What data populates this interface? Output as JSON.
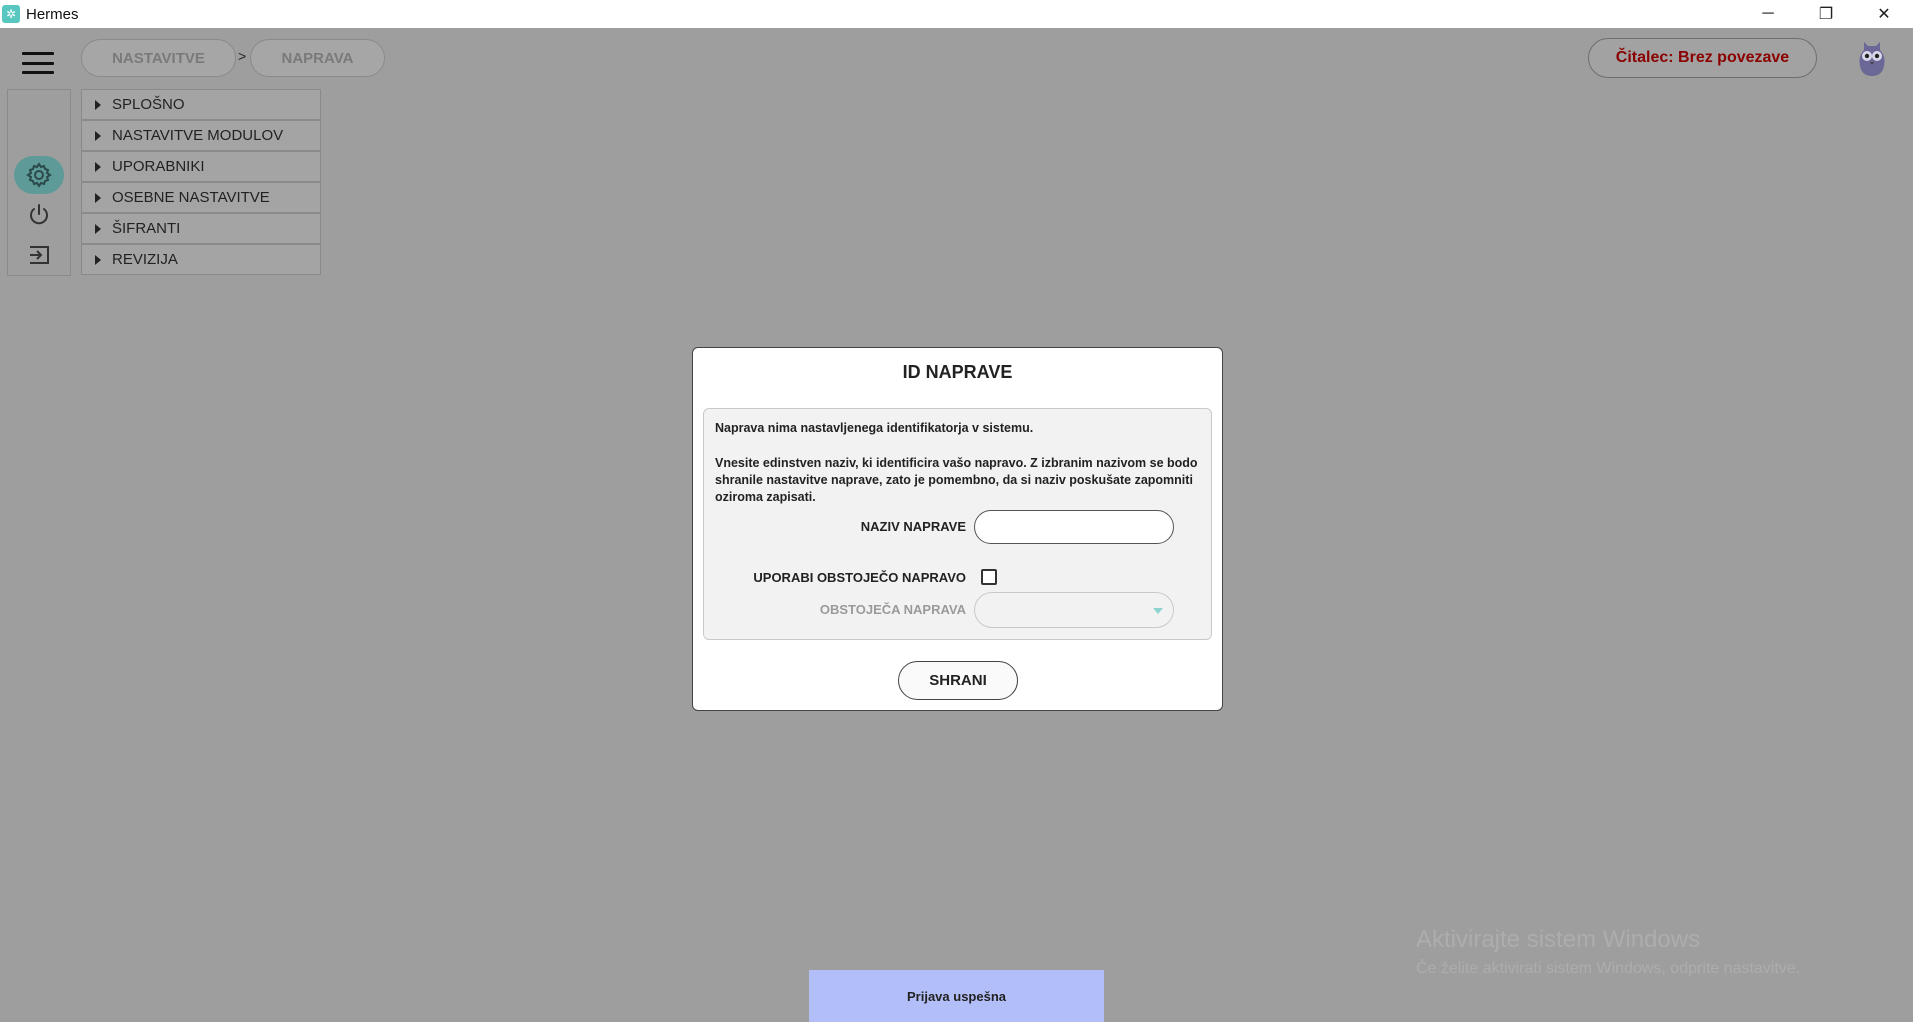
{
  "window": {
    "title": "Hermes",
    "controls": {
      "minimize": "─",
      "restore": "❐",
      "close": "✕"
    }
  },
  "breadcrumb": {
    "items": [
      "NASTAVITVE",
      "NAPRAVA"
    ],
    "separator": ">"
  },
  "reader_status": "Čitalec: Brez povezave",
  "rail": {
    "icons": [
      "gear-icon",
      "power-icon",
      "logout-icon"
    ],
    "active": "gear-icon"
  },
  "settings_tree": [
    {
      "label": "SPLOŠNO"
    },
    {
      "label": "NASTAVITVE MODULOV"
    },
    {
      "label": "UPORABNIKI"
    },
    {
      "label": "OSEBNE NASTAVITVE"
    },
    {
      "label": "ŠIFRANTI"
    },
    {
      "label": "REVIZIJA"
    }
  ],
  "dialog": {
    "title": "ID NAPRAVE",
    "message_1": "Naprava nima nastavljenega identifikatorja v sistemu.",
    "message_2": "Vnesite edinstven naziv, ki identificira vašo napravo. Z izbranim nazivom se bodo shranile nastavitve naprave, zato je pomembno, da si naziv poskušate zapomniti oziroma zapisati.",
    "device_name_label": "NAZIV NAPRAVE",
    "device_name_value": "",
    "use_existing_label": "UPORABI OBSTOJEČO NAPRAVO",
    "use_existing_checked": false,
    "existing_device_label": "OBSTOJEČA NAPRAVA",
    "existing_device_value": "",
    "save_label": "SHRANI"
  },
  "toast": "Prijava uspešna",
  "watermark": {
    "title": "Aktivirajte sistem Windows",
    "subtitle": "Če želite aktivirati sistem Windows, odprite nastavitve."
  },
  "colors": {
    "background": "#9e9e9e",
    "reader_status_text": "#8b0000",
    "active_rail": "#5e9a98",
    "toast_bg": "#b2bef8",
    "app_icon": "#57c7c0"
  }
}
